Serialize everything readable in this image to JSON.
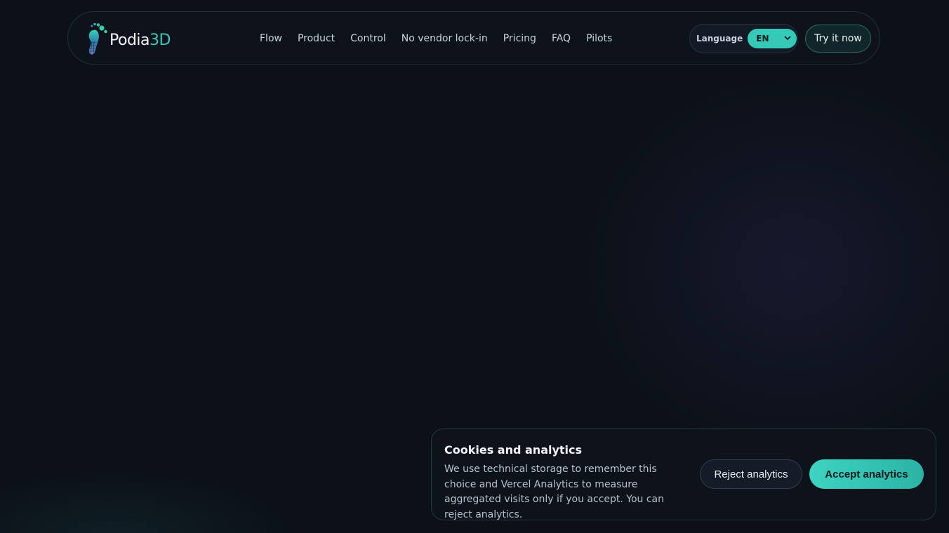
{
  "header": {
    "logo": {
      "text_main": "Podia",
      "text_accent": "3D",
      "icon": "footprint-logo-icon"
    },
    "nav": [
      {
        "label": "Flow"
      },
      {
        "label": "Product"
      },
      {
        "label": "Control"
      },
      {
        "label": "No vendor lock-in"
      },
      {
        "label": "Pricing"
      },
      {
        "label": "FAQ"
      },
      {
        "label": "Pilots"
      }
    ],
    "language": {
      "label": "Language",
      "selected": "EN"
    },
    "cta_label": "Try it now"
  },
  "cookie_banner": {
    "title": "Cookies and analytics",
    "text": "We use technical storage to remember this choice and Vercel Analytics to measure aggregated visits only if you accept. You can reject analytics.",
    "reject_label": "Reject analytics",
    "accept_label": "Accept analytics"
  },
  "colors": {
    "background": "#0c1119",
    "accent": "#35c9b8",
    "text": "#e6eaf0"
  }
}
